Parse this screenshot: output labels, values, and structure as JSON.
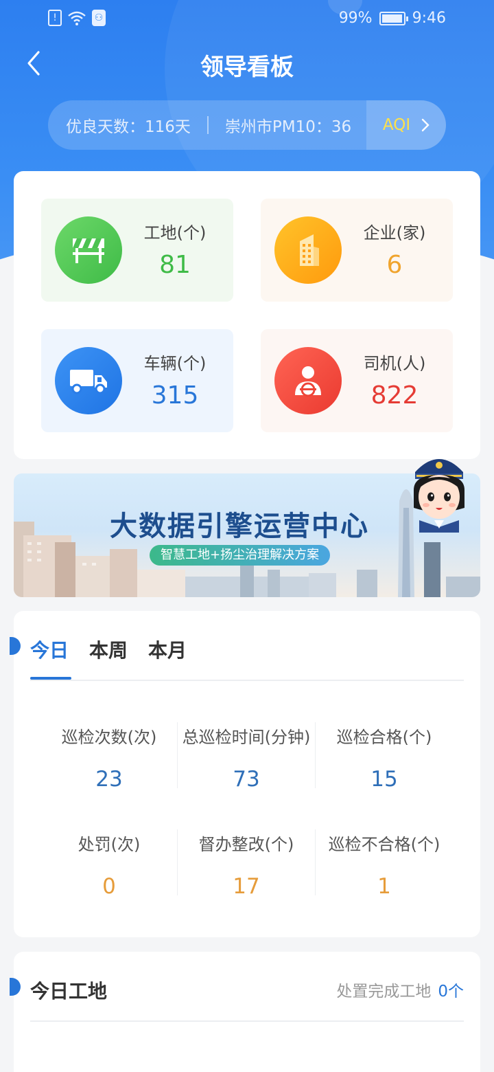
{
  "status_bar": {
    "battery_percent_label": "99%",
    "time": "9:46",
    "battery_level": 0.99,
    "icons": [
      "alert-icon",
      "wifi-icon",
      "app-notification-icon",
      "battery-icon"
    ]
  },
  "header": {
    "title": "领导看板",
    "back_icon": "chevron-left-icon"
  },
  "aqi_bar": {
    "good_days": "优良天数：116天",
    "pm10": "崇州市PM10：36",
    "aqi_label": "AQI",
    "aqi_label_color": "#ffe14a"
  },
  "stats": [
    {
      "label": "工地(个)",
      "value": "81",
      "icon": "construction-barrier-icon",
      "color": "#3fbb47"
    },
    {
      "label": "企业(家)",
      "value": "6",
      "icon": "building-icon",
      "color": "#f0a42d"
    },
    {
      "label": "车辆(个)",
      "value": "315",
      "icon": "truck-icon",
      "color": "#2876d8"
    },
    {
      "label": "司机(人)",
      "value": "822",
      "icon": "driver-icon",
      "color": "#e53b34"
    }
  ],
  "banner": {
    "title": "大数据引擎运营中心",
    "subtitle": "智慧工地+扬尘治理解决方案"
  },
  "inspection": {
    "tabs": [
      "今日",
      "本周",
      "本月"
    ],
    "active_tab": "今日",
    "metrics": [
      {
        "label": "巡检次数(次)",
        "value": "23"
      },
      {
        "label": "总巡检时间(分钟)",
        "value": "73"
      },
      {
        "label": "巡检合格(个)",
        "value": "15"
      },
      {
        "label": "处罚(次)",
        "value": "0"
      },
      {
        "label": "督办整改(个)",
        "value": "17"
      },
      {
        "label": "巡检不合格(个)",
        "value": "1"
      }
    ]
  },
  "today_sites": {
    "title": "今日工地",
    "completed_label": "处置完成工地",
    "completed_count": "0个"
  }
}
